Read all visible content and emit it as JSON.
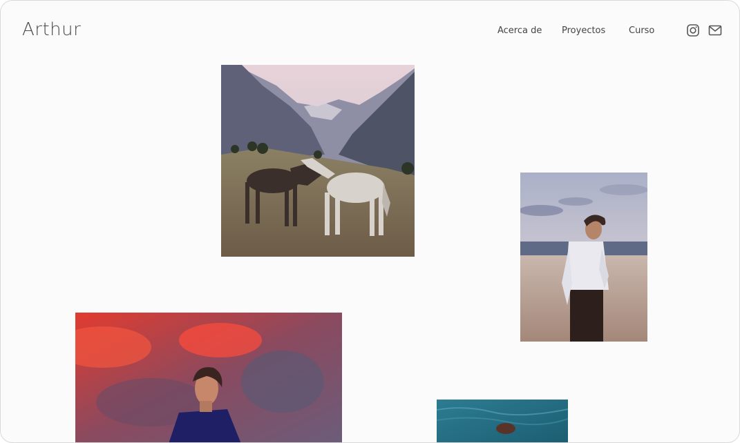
{
  "site": {
    "brand": "Arthur"
  },
  "nav": {
    "items": [
      {
        "label": "Acerca de"
      },
      {
        "label": "Proyectos"
      },
      {
        "label": "Curso"
      }
    ]
  },
  "social": {
    "icons": [
      "instagram-icon",
      "mail-icon"
    ]
  },
  "colors": {
    "background": "#fbfbfb",
    "text": "#4a4a4a",
    "nav_text": "#444444"
  }
}
